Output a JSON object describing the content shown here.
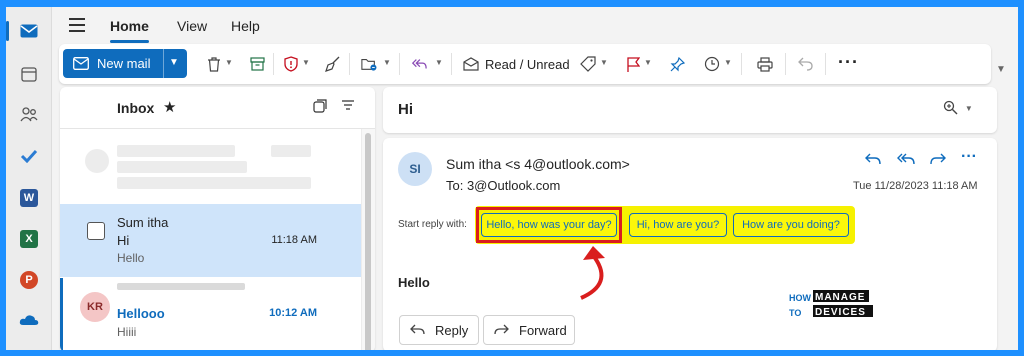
{
  "nav": {
    "tabs": [
      "Home",
      "View",
      "Help"
    ]
  },
  "toolbar": {
    "new_mail_label": "New mail",
    "read_unread_label": "Read / Unread"
  },
  "inbox": {
    "title": "Inbox",
    "messages": [
      {
        "sender": "Sum itha",
        "subject": "Hi",
        "preview": "Hello",
        "time": "11:18 AM"
      },
      {
        "initials": "KR",
        "subject": "Hellooo",
        "preview": "Hiiii",
        "time": "10:12 AM"
      }
    ]
  },
  "reading": {
    "subject": "Hi",
    "avatar_initials": "SI",
    "from": "Sum itha <s                 4@outlook.com>",
    "to": "To:                 3@Outlook.com",
    "date": "Tue 11/28/2023 11:18 AM",
    "start_reply_label": "Start reply with:",
    "suggestions": [
      "Hello, how was your day?",
      "Hi, how are you?",
      "How are you doing?"
    ],
    "body": "Hello",
    "reply_label": "Reply",
    "forward_label": "Forward"
  },
  "watermark": {
    "line1a": "HOW",
    "line1b": "MANAGE",
    "line2a": "TO",
    "line2b": "DEVICES"
  },
  "colors": {
    "accent": "#0f6cbd",
    "highlight": "#fbf70a",
    "annotation": "#d91e1e"
  }
}
